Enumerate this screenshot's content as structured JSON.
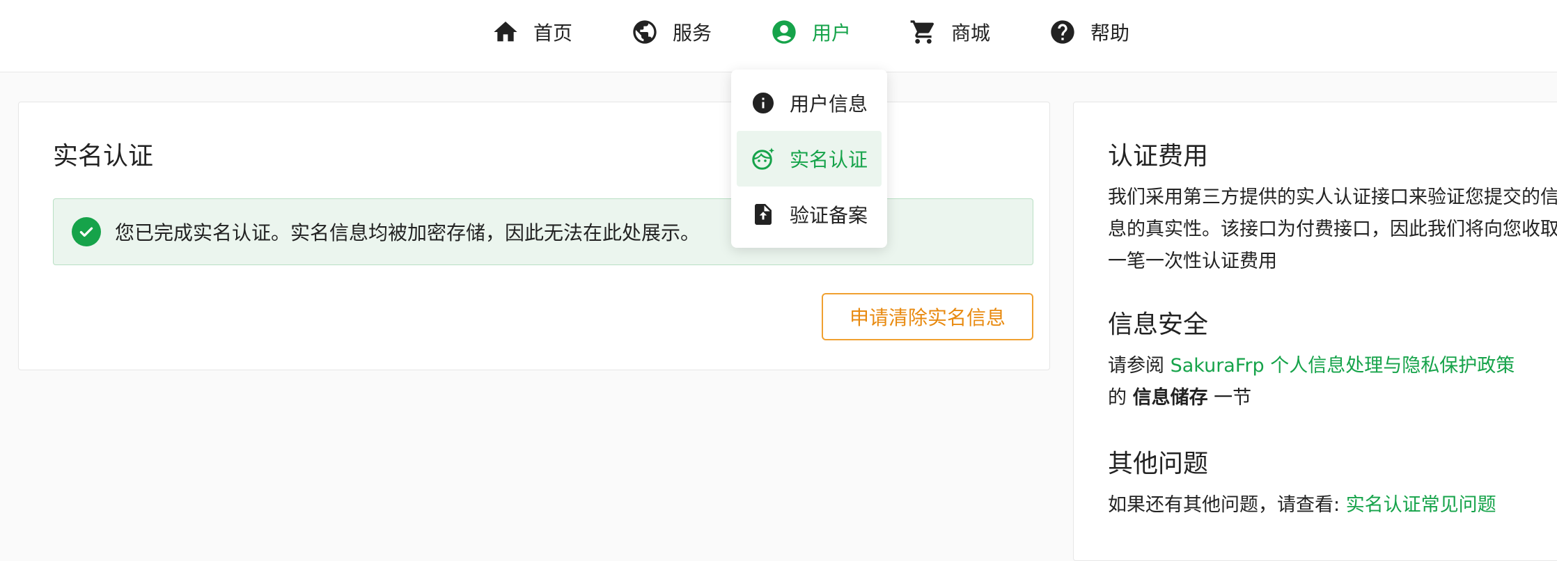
{
  "nav": {
    "items": [
      {
        "label": "首页",
        "icon": "home-icon"
      },
      {
        "label": "服务",
        "icon": "globe-icon"
      },
      {
        "label": "用户",
        "icon": "user-circle-icon",
        "active": true
      },
      {
        "label": "商城",
        "icon": "cart-icon"
      },
      {
        "label": "帮助",
        "icon": "help-icon"
      }
    ]
  },
  "dropdown": {
    "items": [
      {
        "label": "用户信息",
        "icon": "info-icon"
      },
      {
        "label": "实名认证",
        "icon": "face-icon",
        "active": true
      },
      {
        "label": "验证备案",
        "icon": "file-upload-icon"
      }
    ]
  },
  "main": {
    "title": "实名认证",
    "alert": "您已完成实名认证。实名信息均被加密存储，因此无法在此处展示。",
    "clear_button": "申请清除实名信息"
  },
  "side": {
    "fee_title": "认证费用",
    "fee_text": "我们采用第三方提供的实人认证接口来验证您提交的信息的真实性。该接口为付费接口，因此我们将向您收取一笔一次性认证费用",
    "security_title": "信息安全",
    "security_prefix": "请参阅 ",
    "security_link": "SakuraFrp 个人信息处理与隐私保护政策",
    "security_mid": "的 ",
    "security_bold": "信息储存",
    "security_suffix": " 一节",
    "other_title": "其他问题",
    "other_prefix": "如果还有其他问题，请查看: ",
    "other_link": "实名认证常见问题"
  },
  "colors": {
    "accent": "#16a34a",
    "warning": "#e88a10",
    "success_bg": "#ebf5ee"
  }
}
